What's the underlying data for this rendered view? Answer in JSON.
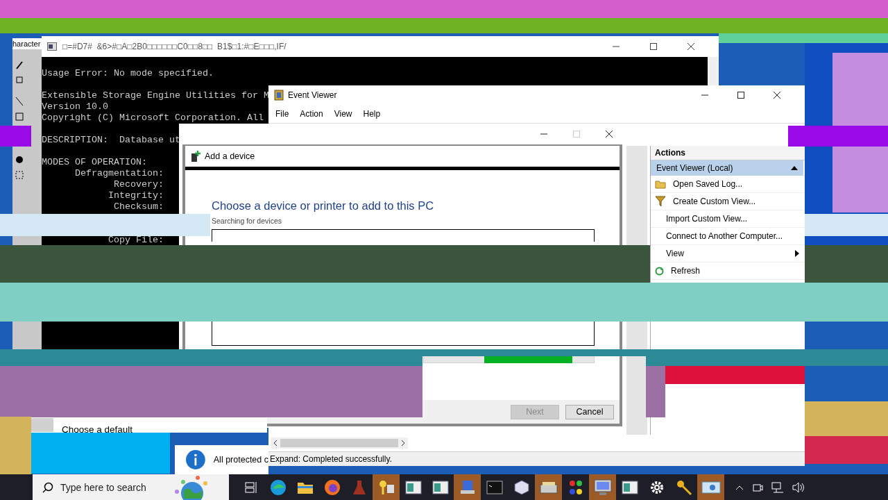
{
  "paint": {
    "label": "haracter"
  },
  "console": {
    "title": "□=#D7#  &6>#□A□2B0□□□□□□C0□□8□□  B1$□1:#□E□□□,IF/",
    "blocks": [
      [
        "Usage Error: No mode specified."
      ],
      [
        "Extensible Storage Engine Utilities for M",
        "Version 10.0",
        "Copyright (C) Microsoft Corporation. All"
      ],
      [
        "DESCRIPTION:  Database ut"
      ],
      [
        "MODES OF OPERATION:",
        "      Defragmentation:",
        "             Recovery:",
        "            Integrity:",
        "             Checksum:"
      ]
    ],
    "tail": "            Copy File:"
  },
  "event_viewer": {
    "title": "Event Viewer",
    "menu": [
      "File",
      "Action",
      "View",
      "Help"
    ],
    "actions_title": "Actions",
    "group": {
      "label": "Event Viewer (Local)",
      "expanded": true
    },
    "actions": [
      {
        "label": "Open Saved Log...",
        "kind": "folder",
        "submenu": false
      },
      {
        "label": "Create Custom View...",
        "kind": "filter",
        "submenu": false
      },
      {
        "label": "Import Custom View...",
        "kind": "plain",
        "submenu": false
      },
      {
        "label": "Connect to Another Computer...",
        "kind": "plain",
        "submenu": false
      },
      {
        "label": "View",
        "kind": "plain",
        "submenu": true
      },
      {
        "label": "Refresh",
        "kind": "refresh",
        "submenu": false
      }
    ],
    "status": "Expand:  Completed successfully."
  },
  "dialog": {
    "title": "Add a device",
    "heading": "Choose a device or printer to add to this PC",
    "status": "Searching for devices",
    "buttons": [
      {
        "label": "Next",
        "disabled": true
      },
      {
        "label": "Cancel",
        "disabled": false
      }
    ]
  },
  "behind": {
    "choose_default": "Choose a default",
    "notice": "All protected c"
  },
  "taskbar": {
    "search_placeholder": "Type here to search",
    "apps": [
      {
        "kind": "taskview",
        "highlighted": false
      },
      {
        "kind": "edge",
        "highlighted": false
      },
      {
        "kind": "folder",
        "highlighted": false
      },
      {
        "kind": "firefox",
        "highlighted": false
      },
      {
        "kind": "flask",
        "highlighted": false
      },
      {
        "kind": "keys",
        "highlighted": true
      },
      {
        "kind": "window",
        "highlighted": false
      },
      {
        "kind": "window",
        "highlighted": false
      },
      {
        "kind": "network",
        "highlighted": true
      },
      {
        "kind": "terminal",
        "highlighted": false
      },
      {
        "kind": "cube",
        "highlighted": false
      },
      {
        "kind": "scanner",
        "highlighted": true
      },
      {
        "kind": "colors",
        "highlighted": false
      },
      {
        "kind": "monitor",
        "highlighted": true
      },
      {
        "kind": "window",
        "highlighted": false
      },
      {
        "kind": "gear",
        "highlighted": false
      },
      {
        "kind": "key",
        "highlighted": false
      },
      {
        "kind": "card",
        "highlighted": true
      }
    ]
  }
}
